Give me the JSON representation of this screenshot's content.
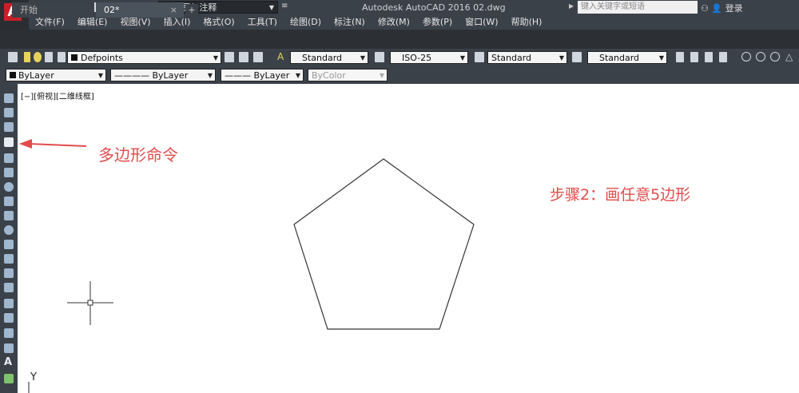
{
  "app": {
    "logo": "A",
    "title": "Autodesk AutoCAD 2016    02.dwg"
  },
  "workspace": {
    "value": "草图与注释"
  },
  "search": {
    "placeholder": "键入关键字或短语"
  },
  "user": {
    "login_label": "登录"
  },
  "menu": [
    "文件(F)",
    "编辑(E)",
    "视图(V)",
    "插入(I)",
    "格式(O)",
    "工具(T)",
    "绘图(D)",
    "标注(N)",
    "修改(M)",
    "参数(P)",
    "窗口(W)",
    "帮助(H)"
  ],
  "tabs": [
    {
      "label": "开始"
    },
    {
      "label": "02*",
      "close": "×"
    }
  ],
  "tab_add": "+",
  "toolbar1": {
    "layer": "Defpoints",
    "text_style": "Standard",
    "dim_style": "ISO-25",
    "table_style": "Standard",
    "mleader_style": "Standard"
  },
  "toolbar2": {
    "color": "ByLayer",
    "linetype": "———— ByLayer",
    "lineweight": "——— ByLayer",
    "plotstyle": "ByColor"
  },
  "viewport_label": "[−][俯视][二维线框]",
  "annotations": {
    "polygon_cmd": "多边形命令",
    "step2": "步骤2：画任意5边形"
  },
  "ucs": {
    "y_label": "Y"
  },
  "colors": {
    "annotation": "#e24b4b",
    "panel": "#3b4149",
    "logo": "#c8202a"
  },
  "icons": [
    "line-icon",
    "polyline-icon",
    "polygon-icon",
    "rectangle-icon",
    "arc-icon",
    "circle-icon",
    "revcloud-icon",
    "spline-icon",
    "ellipse-icon",
    "insert-block-icon",
    "make-block-icon",
    "point-icon",
    "hatch-icon",
    "gradient-icon",
    "region-icon",
    "table-icon",
    "mtext-icon",
    "add-selected-icon"
  ]
}
